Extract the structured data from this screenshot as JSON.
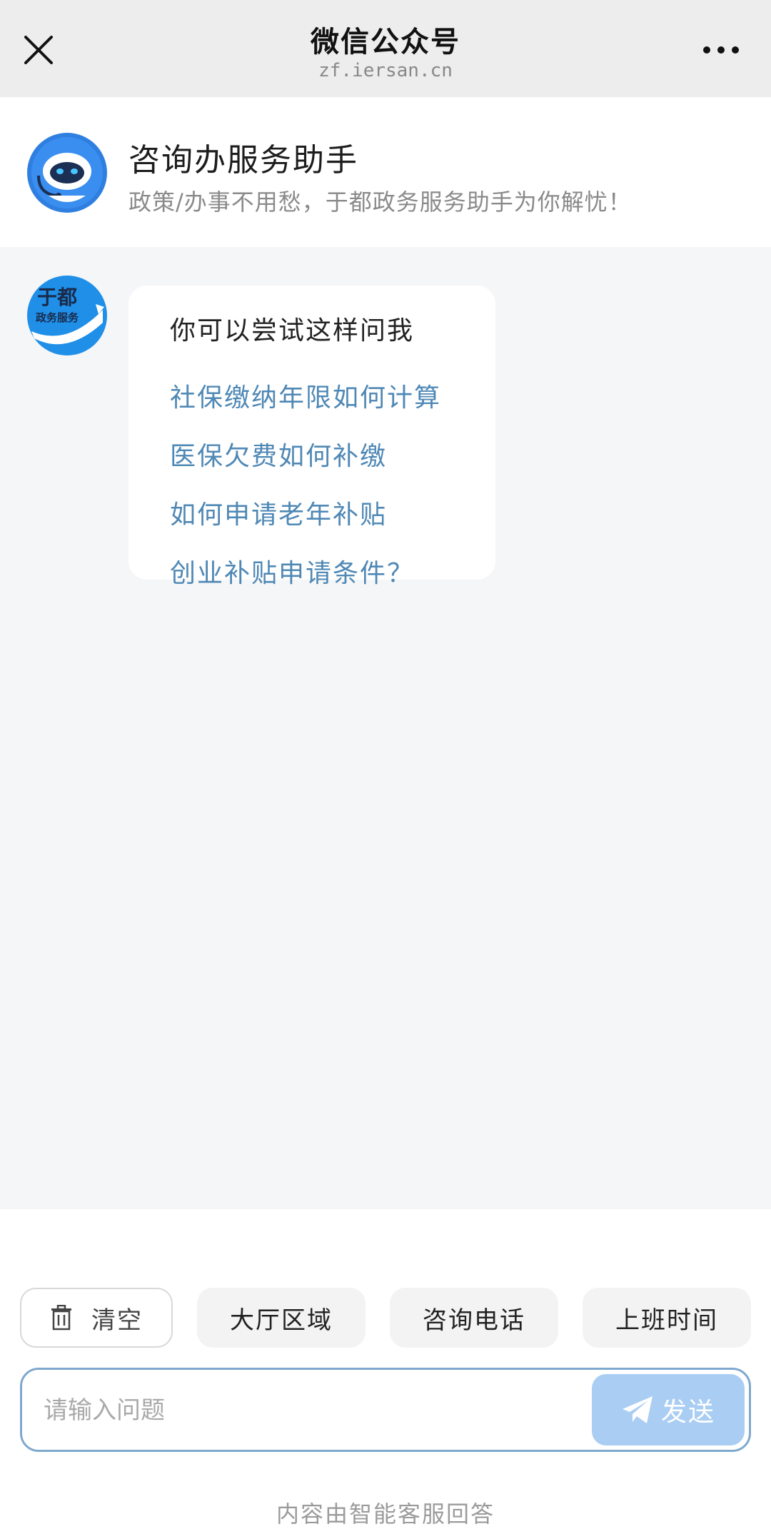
{
  "topbar": {
    "title": "微信公众号",
    "domain": "zf.iersan.cn",
    "close_icon": "close-icon",
    "more_icon": "more-dots-icon"
  },
  "header": {
    "title": "咨询办服务助手",
    "subtitle": "政策/办事不用愁，于都政务服务助手为你解忧！"
  },
  "chat": {
    "avatar_logo_text_1": "于都",
    "avatar_logo_text_2": "政务服务",
    "bubble_title": "你可以尝试这样问我",
    "suggestions": [
      "社保缴纳年限如何计算",
      "医保欠费如何补缴",
      "如何申请老年补贴",
      "创业补贴申请条件？"
    ]
  },
  "quick_buttons": {
    "clear": "清空",
    "hall_area": "大厅区域",
    "phone": "咨询电话",
    "work_hours": "上班时间"
  },
  "input": {
    "placeholder": "请输入问题",
    "send_label": "发送"
  },
  "footer": {
    "note": "内容由智能客服回答"
  },
  "colors": {
    "link": "#4f88b5",
    "send_button": "#a9cdf3",
    "input_border": "#7fa8cf"
  }
}
